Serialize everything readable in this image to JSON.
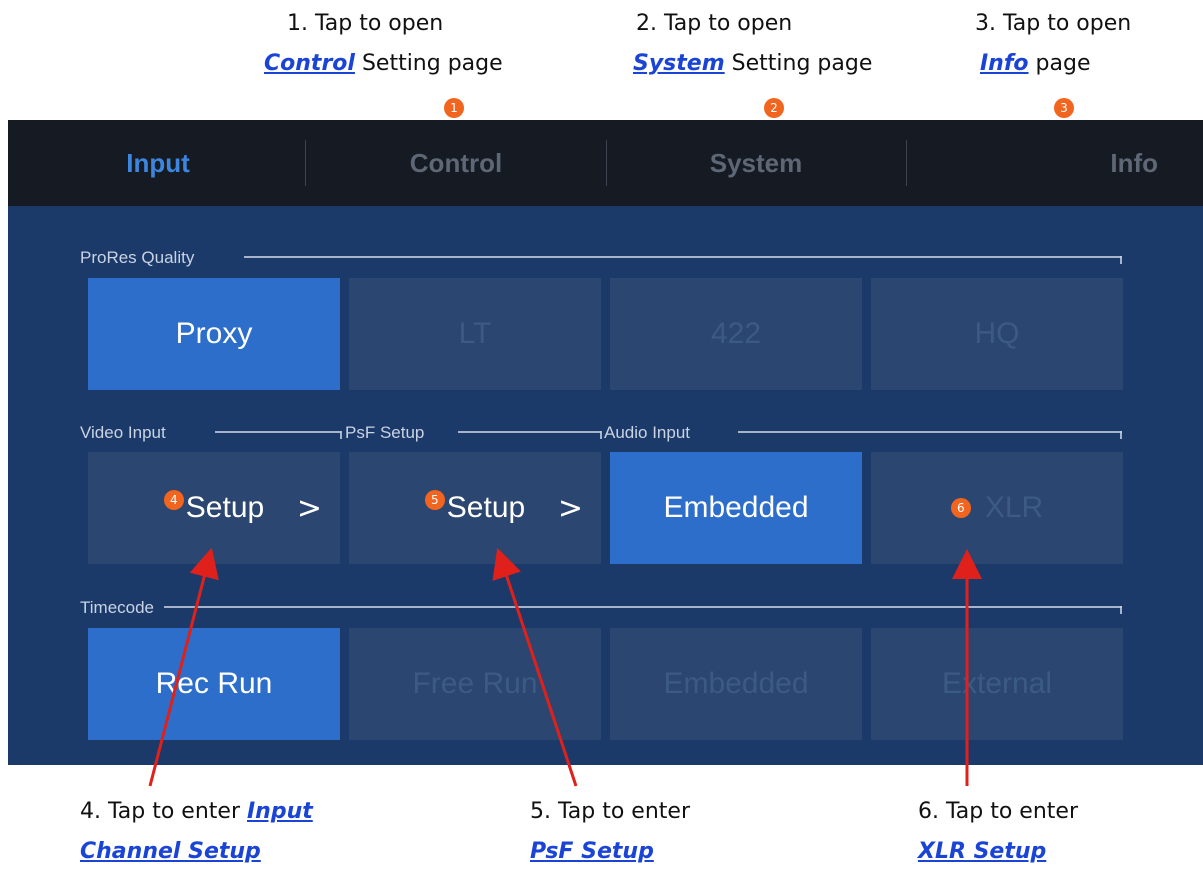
{
  "callouts_top": [
    {
      "line1": "1. Tap to open",
      "link": "Control",
      "rest": " Setting page",
      "badge": "1"
    },
    {
      "line1": "2. Tap to open",
      "link": "System",
      "rest": " Setting page",
      "badge": "2"
    },
    {
      "line1": "3. Tap to open",
      "link": "Info",
      "rest": " page",
      "badge": "3"
    }
  ],
  "tabs": [
    "Input",
    "Control",
    "System",
    "Info"
  ],
  "prores": {
    "label": "ProRes Quality",
    "options": [
      "Proxy",
      "LT",
      "422",
      "HQ"
    ],
    "selected": "Proxy"
  },
  "video_input": {
    "label": "Video Input",
    "button": "Setup",
    "badge": "4"
  },
  "psf_setup": {
    "label": "PsF Setup",
    "button": "Setup",
    "badge": "5"
  },
  "audio_input": {
    "label": "Audio Input",
    "options": [
      "Embedded",
      "XLR"
    ],
    "selected": "Embedded",
    "badge": "6"
  },
  "timecode": {
    "label": "Timecode",
    "options": [
      "Rec Run",
      "Free Run",
      "Embedded",
      "External"
    ],
    "selected": "Rec Run"
  },
  "chevron": ">",
  "callouts_bottom": [
    {
      "line1": "4. Tap to enter ",
      "link1": "Input",
      "link2": "Channel Setup"
    },
    {
      "line1": "5. Tap to enter",
      "link2": "PsF Setup"
    },
    {
      "line1": "6. Tap to enter",
      "link2": "XLR Setup"
    }
  ],
  "colors": {
    "accent": "#2c6ec9",
    "badge": "#f2651f",
    "arrow": "#e0201a",
    "link": "#1a44d6"
  }
}
